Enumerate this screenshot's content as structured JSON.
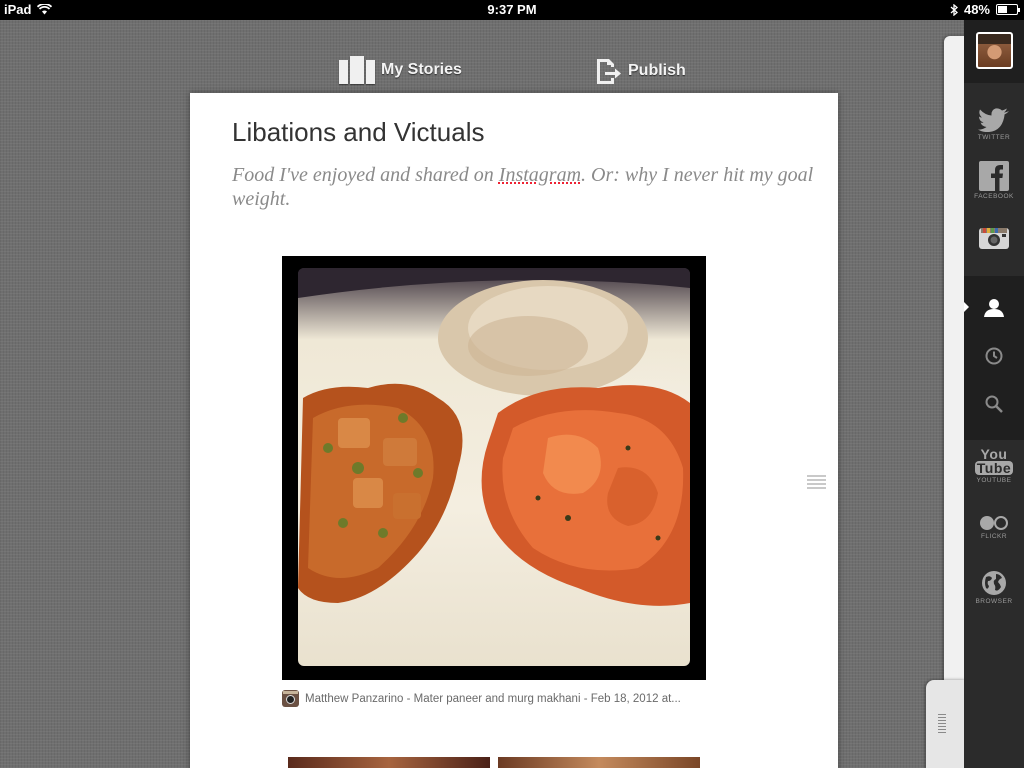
{
  "status_bar": {
    "device": "iPad",
    "time": "9:37 PM",
    "battery_percent": "48%",
    "battery_level": 0.48
  },
  "toolbar": {
    "my_stories_label": "My Stories",
    "publish_label": "Publish"
  },
  "story": {
    "title": "Libations and Victuals",
    "subtitle_before": "Food I've enjoyed and shared on ",
    "subtitle_link": "Instagram",
    "subtitle_after": ". Or: why I never hit my goal weight.",
    "photo_caption": "Matthew Panzarino - Mater paneer and murg makhani - Feb 18, 2012 at..."
  },
  "sidebar": {
    "items": [
      {
        "label": "Twitter",
        "icon": "twitter-icon"
      },
      {
        "label": "Facebook",
        "icon": "facebook-icon"
      },
      {
        "label": "",
        "icon": "instagram-icon"
      },
      {
        "label": "",
        "icon": "user-icon",
        "active": true
      },
      {
        "label": "",
        "icon": "clock-icon"
      },
      {
        "label": "",
        "icon": "search-icon"
      },
      {
        "label": "YouTube",
        "icon": "youtube-icon",
        "logo_text_1": "You",
        "logo_text_2": "Tube"
      },
      {
        "label": "Flickr",
        "icon": "flickr-icon"
      },
      {
        "label": "Browser",
        "icon": "globe-icon"
      }
    ]
  },
  "colors": {
    "linen_background": "#6f6f6f",
    "sidebar_background": "#2b2b2b",
    "title_text": "#333333",
    "subtitle_text": "#8a8a8a"
  }
}
